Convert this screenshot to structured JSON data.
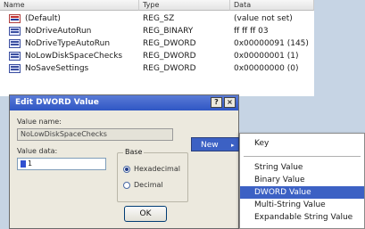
{
  "list": {
    "columns": {
      "name": "Name",
      "type": "Type",
      "data": "Data"
    },
    "rows": [
      {
        "name": "(Default)",
        "type": "REG_SZ",
        "data": "(value not set)",
        "icon": "string-value-icon"
      },
      {
        "name": "NoDriveAutoRun",
        "type": "REG_BINARY",
        "data": "ff ff ff 03",
        "icon": "binary-value-icon"
      },
      {
        "name": "NoDriveTypeAutoRun",
        "type": "REG_DWORD",
        "data": "0x00000091 (145)",
        "icon": "dword-value-icon"
      },
      {
        "name": "NoLowDiskSpaceChecks",
        "type": "REG_DWORD",
        "data": "0x00000001 (1)",
        "icon": "dword-value-icon"
      },
      {
        "name": "NoSaveSettings",
        "type": "REG_DWORD",
        "data": "0x00000000 (0)",
        "icon": "dword-value-icon"
      }
    ]
  },
  "dialog": {
    "title": "Edit DWORD Value",
    "help_button": "?",
    "close_button": "×",
    "value_name_label": "Value name:",
    "value_name": "NoLowDiskSpaceChecks",
    "value_data_label": "Value data:",
    "value_data": "1",
    "base_label": "Base",
    "base_options": [
      "Hexadecimal",
      "Decimal"
    ],
    "base_selected": "Hexadecimal",
    "ok_label": "OK"
  },
  "context_menu": {
    "new_label": "New",
    "new_arrow": "▸",
    "submenu": [
      "Key",
      "String Value",
      "Binary Value",
      "DWORD Value",
      "Multi-String Value",
      "Expandable String Value"
    ],
    "highlighted": "DWORD Value"
  },
  "colors": {
    "selection": "#3c61c4",
    "title_bar": "#2f56c4",
    "dialog_bg": "#ece9de"
  }
}
